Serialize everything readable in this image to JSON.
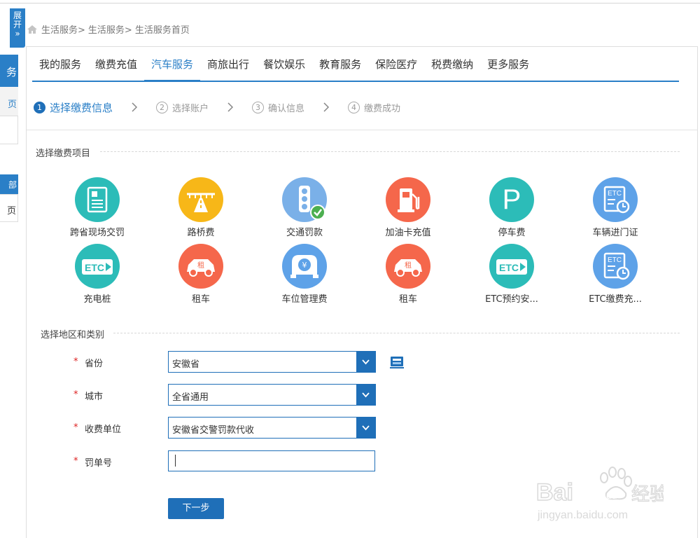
{
  "sidebar": {
    "expand_label_top": "展",
    "expand_label_bottom": "开",
    "expand_glyph": "»",
    "item_a": "务",
    "item_b": "页",
    "item_d": "部",
    "item_e": "页"
  },
  "breadcrumb": [
    "生活服务>",
    "生活服务>",
    "生活服务首页"
  ],
  "tabs": [
    {
      "label": "我的服务",
      "active": false
    },
    {
      "label": "缴费充值",
      "active": false
    },
    {
      "label": "汽车服务",
      "active": true
    },
    {
      "label": "商旅出行",
      "active": false
    },
    {
      "label": "餐饮娱乐",
      "active": false
    },
    {
      "label": "教育服务",
      "active": false
    },
    {
      "label": "保险医疗",
      "active": false
    },
    {
      "label": "税费缴纳",
      "active": false
    },
    {
      "label": "更多服务",
      "active": false
    }
  ],
  "steps": [
    {
      "num": "1",
      "label": "选择缴费信息",
      "active": true
    },
    {
      "num": "2",
      "label": "选择账户",
      "active": false
    },
    {
      "num": "3",
      "label": "确认信息",
      "active": false
    },
    {
      "num": "4",
      "label": "缴费成功",
      "active": false
    }
  ],
  "section_items_title": "选择缴费项目",
  "services": [
    {
      "label": "跨省现场交罚",
      "icon": "document-icon",
      "color": "#2cbcb8"
    },
    {
      "label": "路桥费",
      "icon": "road-bridge-icon",
      "color": "#f7b718"
    },
    {
      "label": "交通罚款",
      "icon": "traffic-light-icon",
      "color": "#7ab0e8",
      "selected": true
    },
    {
      "label": "加油卡充值",
      "icon": "fuel-pump-icon",
      "color": "#f5674b"
    },
    {
      "label": "停车费",
      "icon": "parking-icon",
      "color": "#2cbcb8",
      "glyph": "P"
    },
    {
      "label": "车辆进门证",
      "icon": "etc-clock-icon",
      "color": "#5ea2e8",
      "badge": "ETC"
    },
    {
      "label": "充电桩",
      "icon": "etc-card-icon",
      "color": "#2cbcb8",
      "badge": "ETC"
    },
    {
      "label": "租车",
      "icon": "rental-car-icon",
      "color": "#f5674b",
      "badge": "租"
    },
    {
      "label": "车位管理费",
      "icon": "car-yuan-icon",
      "color": "#5ea2e8",
      "badge": "¥"
    },
    {
      "label": "租车",
      "icon": "rental-car-icon",
      "color": "#f5674b",
      "badge": "租"
    },
    {
      "label": "ETC预约安...",
      "icon": "etc-card-icon",
      "color": "#2cbcb8",
      "badge": "ETC"
    },
    {
      "label": "ETC缴费充...",
      "icon": "etc-clock-icon",
      "color": "#5ea2e8",
      "badge": "ETC"
    }
  ],
  "section_region_title": "选择地区和类别",
  "form": {
    "required_mark": "*",
    "province_label": "省份",
    "province_value": "安徽省",
    "city_label": "城市",
    "city_value": "全省通用",
    "unit_label": "收费单位",
    "unit_value": "安徽省交警罚款代收",
    "ticket_label": "罚单号",
    "ticket_value": "",
    "next_label": "下一步"
  },
  "watermark": {
    "text_top": "Bai",
    "text_mid": "du",
    "text_cn": "经验",
    "url": "jingyan.baidu.com"
  },
  "colors": {
    "accent": "#2a7fc7",
    "primary_button": "#1f6fb8",
    "required": "#dd2222"
  }
}
